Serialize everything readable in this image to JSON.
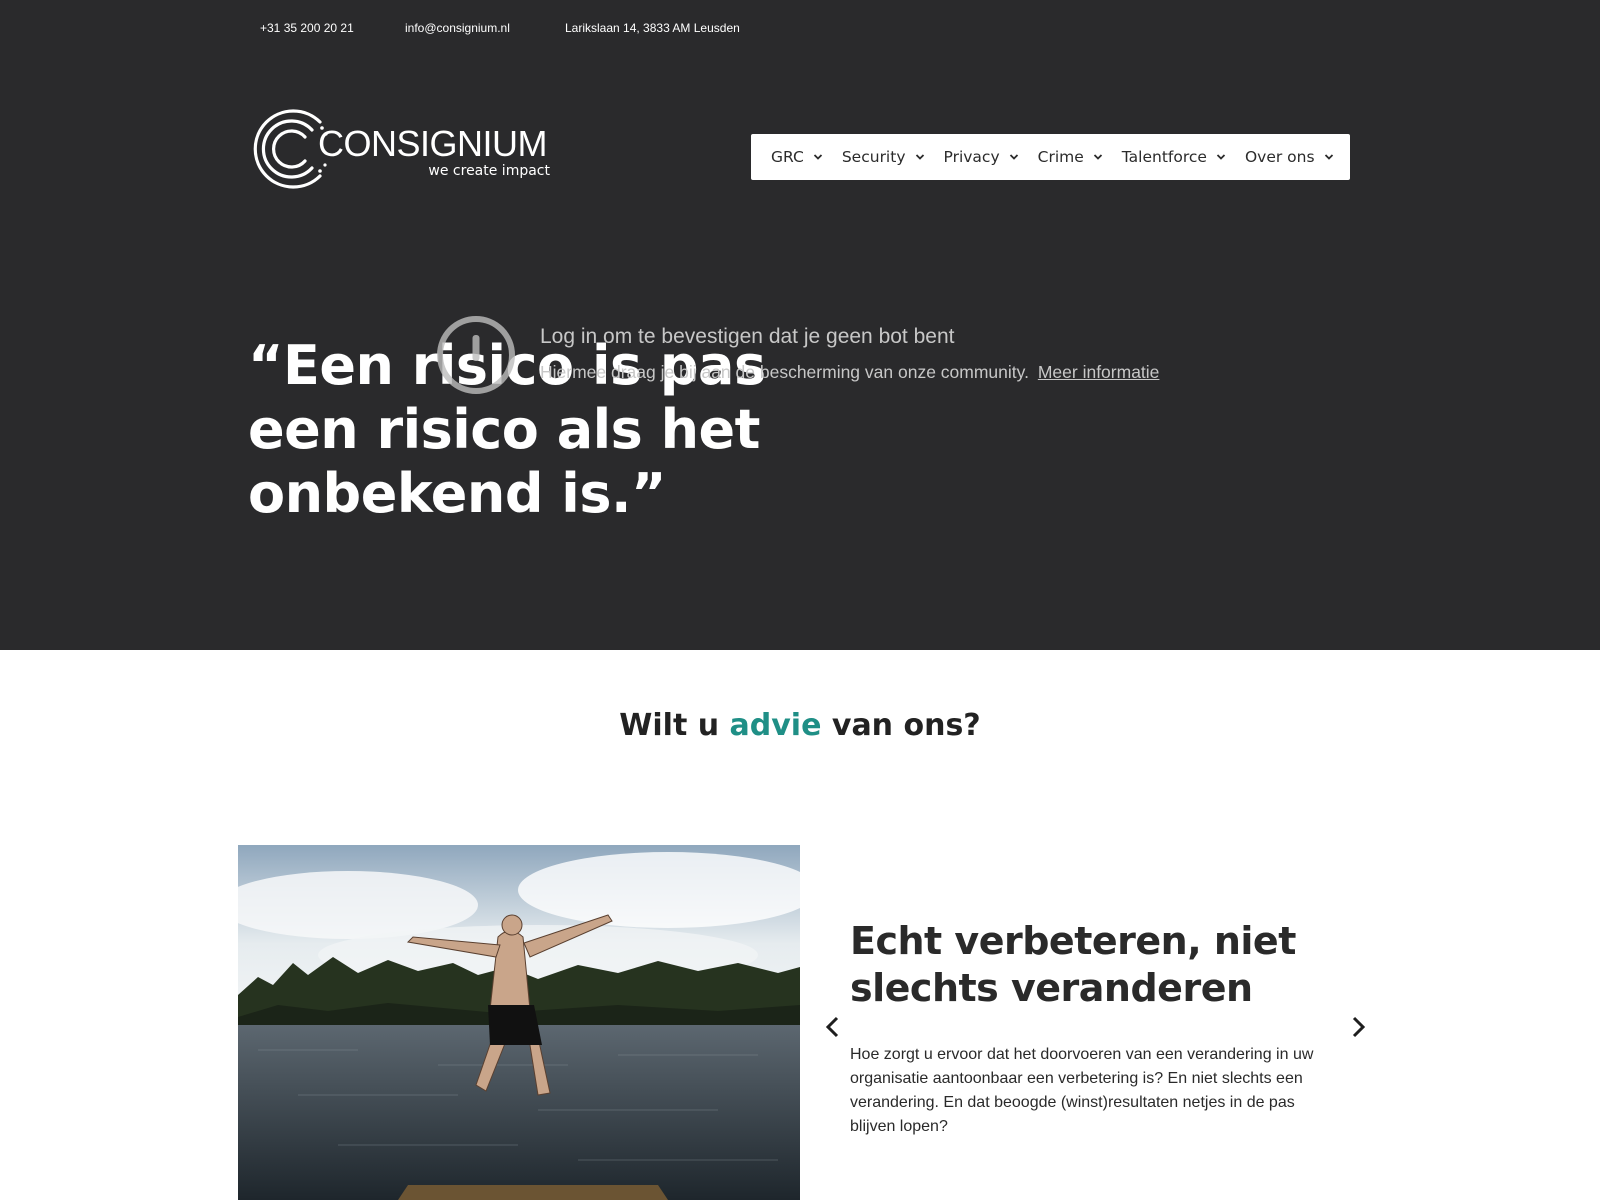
{
  "topbar": {
    "phone": "+31 35 200 20 21",
    "email": "info@consignium.nl",
    "address": "Larikslaan 14, 3833 AM Leusden"
  },
  "logo": {
    "name": "CONSIGNIUM",
    "tagline": "we create impact"
  },
  "nav": {
    "items": [
      {
        "label": "GRC"
      },
      {
        "label": "Security"
      },
      {
        "label": "Privacy"
      },
      {
        "label": "Crime"
      },
      {
        "label": "Talentforce"
      },
      {
        "label": "Over ons"
      }
    ]
  },
  "hero": {
    "quote": "“Een risico is pas een risico als het onbekend is.”"
  },
  "bot_notice": {
    "title": "Log in om te bevestigen dat je geen bot bent",
    "description": "Hiermee draag je bij aan de bescherming van onze community.",
    "link": "Meer informatie"
  },
  "advies": {
    "before": "Wilt u ",
    "accent": "advie",
    "after": " van ons?"
  },
  "slide": {
    "title": "Echt verbeteren, niet slechts veranderen",
    "text": "Hoe zorgt u ervoor dat het doorvoeren van een verandering in uw organisatie aantoonbaar een verbetering is? En niet slechts een verandering. En dat beoogde (winst)resultaten netjes in de pas blijven lopen?"
  },
  "colors": {
    "hero_bg": "#2a2a2c",
    "accent": "#1f8f86"
  }
}
